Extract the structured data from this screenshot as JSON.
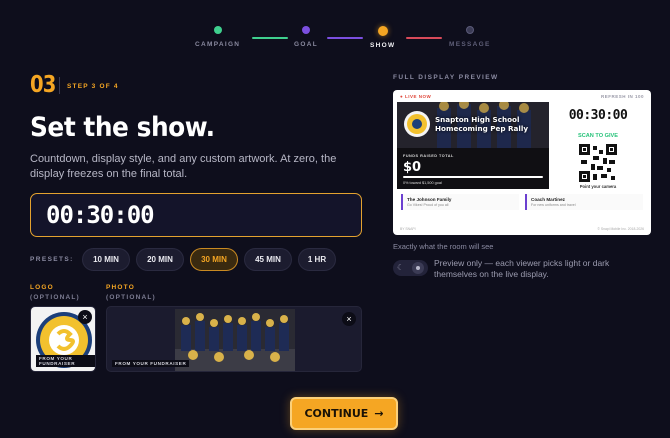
{
  "stepper": {
    "steps": [
      {
        "label": "CAMPAIGN",
        "color": "#3fcf8e"
      },
      {
        "label": "GOAL",
        "color": "#7b4fe0"
      },
      {
        "label": "SHOW",
        "color": "#f5a623"
      },
      {
        "label": "MESSAGE",
        "color": "#3b3b55"
      }
    ]
  },
  "header": {
    "step_number": "03",
    "step_of": "STEP 3 OF 4",
    "title": "Set the show.",
    "subtitle": "Countdown, display style, and any custom artwork. At zero, the display freezes on the final total."
  },
  "timer": {
    "value": "00:30:00"
  },
  "presets": {
    "label": "PRESETS:",
    "options": [
      "10 MIN",
      "20 MIN",
      "30 MIN",
      "45 MIN",
      "1 HR"
    ],
    "selected": "30 MIN"
  },
  "logo": {
    "label": "LOGO",
    "sub": "(OPTIONAL)",
    "badge_text": "EAST SNAPTON",
    "tag": "FROM YOUR FUNDRAISER",
    "close_glyph": "×"
  },
  "photo": {
    "label": "PHOTO",
    "sub": "(OPTIONAL)",
    "tag": "FROM YOUR FUNDRAISER",
    "close_glyph": "×"
  },
  "preview": {
    "section_label": "FULL DISPLAY PREVIEW",
    "live": "● LIVE NOW",
    "refresh": "REFRESH IN 100",
    "school": "Snapton High School Homecoming Pep Rally",
    "raised_label": "FUNDS RAISED TOTAL",
    "raised": "$0",
    "progress": 0,
    "toward": "0% toward $1,500 goal",
    "timer": "00:30:00",
    "scan": "SCAN TO GIVE",
    "point": "Point your camera",
    "feed": [
      {
        "name": "The Johnson Family",
        "msg": "Go Vikes! Proud of you all"
      },
      {
        "name": "Coach Martinez",
        "msg": "For new uniforms and travel"
      }
    ],
    "footer_left": "BY SNAPI",
    "footer_right": "© Snapi Mobile Inc. 2018-2026",
    "caption": "Exactly what the room will see"
  },
  "toggle": {
    "help": "Preview only — each viewer picks light or dark themselves on the live display.",
    "left_glyph": "☾"
  },
  "cta": {
    "label": "CONTINUE",
    "arrow": "→"
  }
}
